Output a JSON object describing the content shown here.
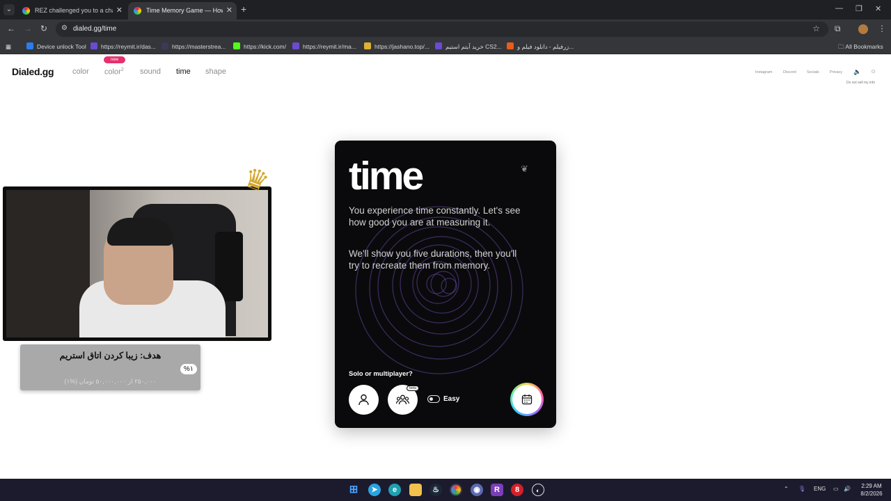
{
  "browser": {
    "tabs": [
      {
        "title": "REZ challenged you to a charac",
        "active": false
      },
      {
        "title": "Time Memory Game — How Go",
        "active": true
      }
    ],
    "url": "dialed.gg/time",
    "bookmarks": [
      {
        "label": "Device unlock Tool",
        "color": "#2b7de9"
      },
      {
        "label": "https://reymit.ir/das...",
        "color": "#6a4bd1"
      },
      {
        "label": "https://masterstrea...",
        "color": "#3a3a55"
      },
      {
        "label": "https://kick.com/",
        "color": "#53fc18"
      },
      {
        "label": "https://reymit.ir/ma...",
        "color": "#6a4bd1"
      },
      {
        "label": "https://jashano.top/...",
        "color": "#e0b030"
      },
      {
        "label": "خرید آیتم استیم CS2...",
        "color": "#6a4bd1"
      },
      {
        "label": "زرفیلم - دانلود فیلم و...",
        "color": "#e85d1a"
      }
    ],
    "all_bookmarks": "All Bookmarks"
  },
  "site": {
    "logo": "Dialed.gg",
    "nav": [
      "color",
      "color",
      "sound",
      "time",
      "shape"
    ],
    "nav_sup": "2",
    "new_badge": "new",
    "topright": [
      "Instagram",
      "Discord",
      "Socials",
      "Privacy"
    ],
    "sell": "Do not sell my info"
  },
  "card": {
    "title": "time",
    "para1": "You experience time constantly. Let's see how good you are at measuring it.",
    "para2": "We'll show you five durations, then you'll try to recreate them from memory.",
    "solo_label": "Solo or multiplayer?",
    "beta": "beta",
    "difficulty": "Easy"
  },
  "overlay": {
    "goal_title": "هدف: زیبا کردن اتاق استریم",
    "goal_percent": "%۱",
    "goal_sub": "۲۵۰,۰۰۰ از ۵۰,۰۰۰,۰۰۰ تومان (%۱)"
  },
  "taskbar": {
    "lang": "ENG",
    "time": "2:29 AM",
    "date": "8/2/2026"
  }
}
